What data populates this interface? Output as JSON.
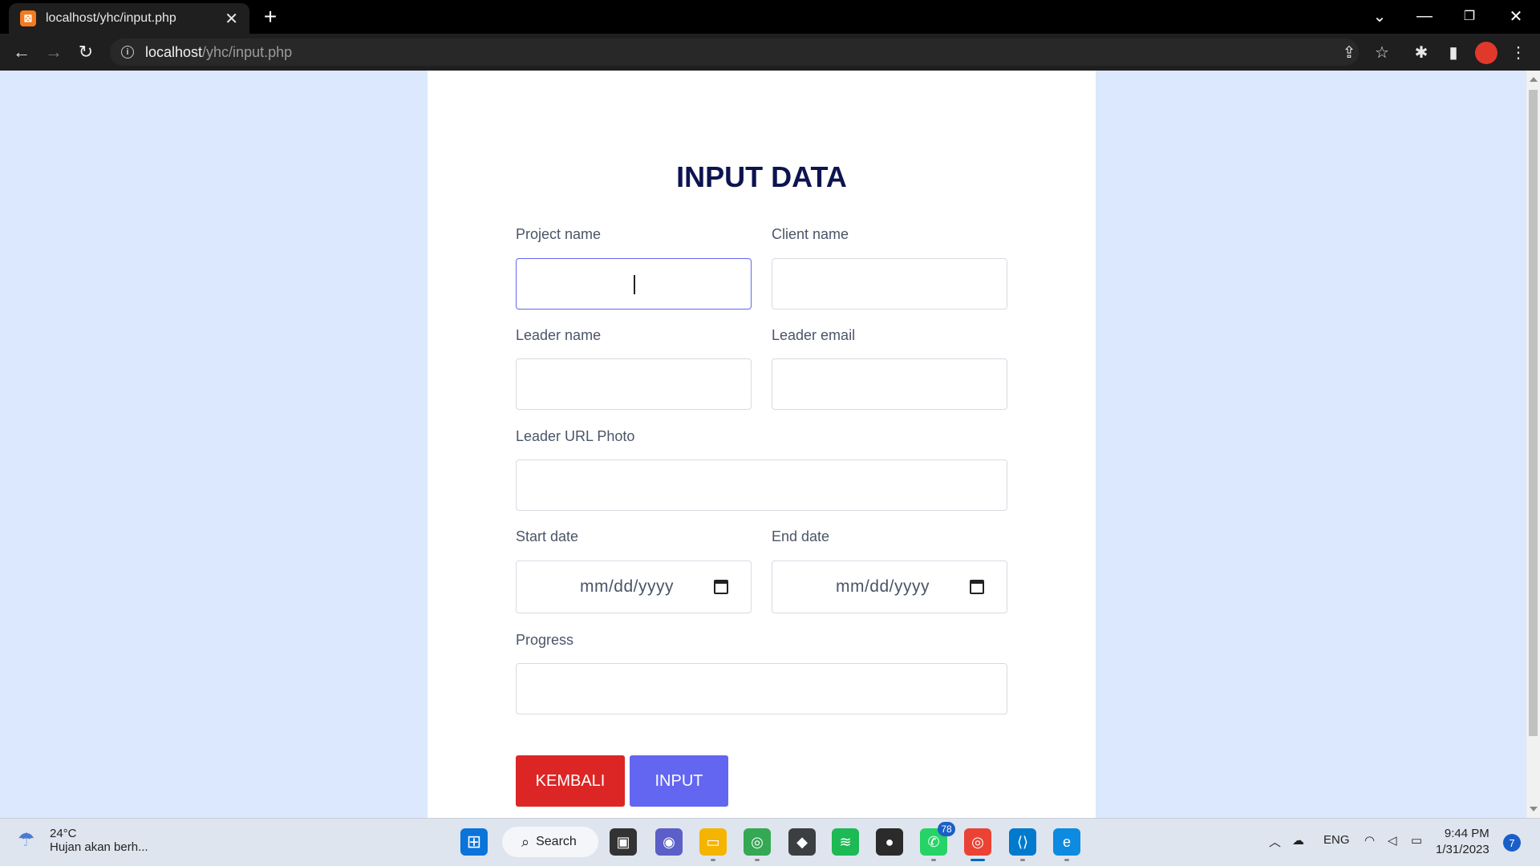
{
  "browser": {
    "tab_title": "localhost/yhc/input.php",
    "tab_favicon": "xampp-icon",
    "url_host": "localhost",
    "url_path": "/yhc/input.php"
  },
  "form": {
    "title": "INPUT DATA",
    "fields": {
      "project_name": {
        "label": "Project name",
        "value": ""
      },
      "client_name": {
        "label": "Client name",
        "value": ""
      },
      "leader_name": {
        "label": "Leader name",
        "value": ""
      },
      "leader_email": {
        "label": "Leader email",
        "value": ""
      },
      "leader_url_photo": {
        "label": "Leader URL Photo",
        "value": ""
      },
      "start_date": {
        "label": "Start date",
        "placeholder": "mm/dd/yyyy"
      },
      "end_date": {
        "label": "End date",
        "placeholder": "mm/dd/yyyy"
      },
      "progress": {
        "label": "Progress",
        "value": ""
      }
    },
    "buttons": {
      "back_label": "KEMBALI",
      "submit_label": "INPUT"
    },
    "colors": {
      "title": "#0d1450",
      "back_button": "#dc2626",
      "submit_button": "#6366f1",
      "page_background": "#dbe8fd"
    }
  },
  "taskbar": {
    "weather_temp": "24°C",
    "weather_desc": "Hujan akan berh...",
    "search_label": "Search",
    "whatsapp_badge": "78",
    "language": "ENG",
    "time": "9:44 PM",
    "date": "1/31/2023",
    "notification_count": "7"
  }
}
